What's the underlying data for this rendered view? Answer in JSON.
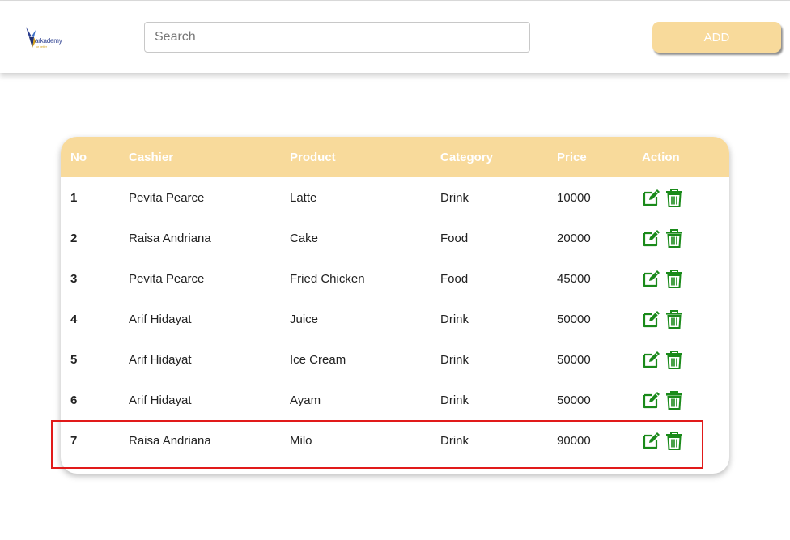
{
  "header": {
    "logo": {
      "brand": "arkademy",
      "tagline": "for better"
    },
    "search": {
      "placeholder": "Search",
      "value": ""
    },
    "add_label": "ADD"
  },
  "table": {
    "columns": [
      "No",
      "Cashier",
      "Product",
      "Category",
      "Price",
      "Action"
    ],
    "rows": [
      {
        "no": "1",
        "cashier": "Pevita Pearce",
        "product": "Latte",
        "category": "Drink",
        "price": "10000"
      },
      {
        "no": "2",
        "cashier": "Raisa Andriana",
        "product": "Cake",
        "category": "Food",
        "price": "20000"
      },
      {
        "no": "3",
        "cashier": "Pevita Pearce",
        "product": "Fried Chicken",
        "category": "Food",
        "price": "45000"
      },
      {
        "no": "4",
        "cashier": "Arif Hidayat",
        "product": "Juice",
        "category": "Drink",
        "price": "50000"
      },
      {
        "no": "5",
        "cashier": "Arif Hidayat",
        "product": "Ice Cream",
        "category": "Drink",
        "price": "50000"
      },
      {
        "no": "6",
        "cashier": "Arif Hidayat",
        "product": "Ayam",
        "category": "Drink",
        "price": "50000"
      },
      {
        "no": "7",
        "cashier": "Raisa Andriana",
        "product": "Milo",
        "category": "Drink",
        "price": "90000"
      }
    ],
    "action_icons": [
      "edit-icon",
      "trash-icon"
    ]
  },
  "colors": {
    "accent": "#f8da9b",
    "action_icon": "#1a8a1a",
    "highlight_border": "#e11a1a"
  }
}
